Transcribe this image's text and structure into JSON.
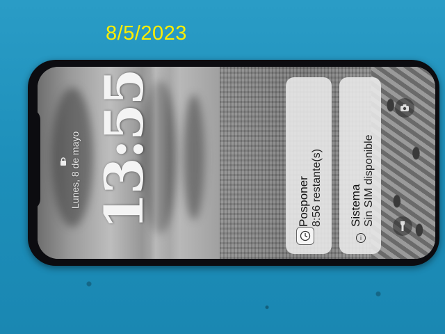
{
  "photo": {
    "date_stamp": "8/5/2023"
  },
  "lock_screen": {
    "date": "Lunes, 8 de mayo",
    "time": "13:55"
  },
  "notifications": [
    {
      "app": "Posponer",
      "text": "8:56 restante(s)",
      "icon": "clock-icon"
    },
    {
      "app": "Sistema",
      "text": "Sin SIM disponible",
      "icon": "info-icon"
    }
  ],
  "quick_actions": {
    "left": "flashlight-icon",
    "right": "camera-icon"
  },
  "colors": {
    "mat": "#1f8fb8",
    "stamp": "#ffee00",
    "bezel": "#0c0c10"
  }
}
